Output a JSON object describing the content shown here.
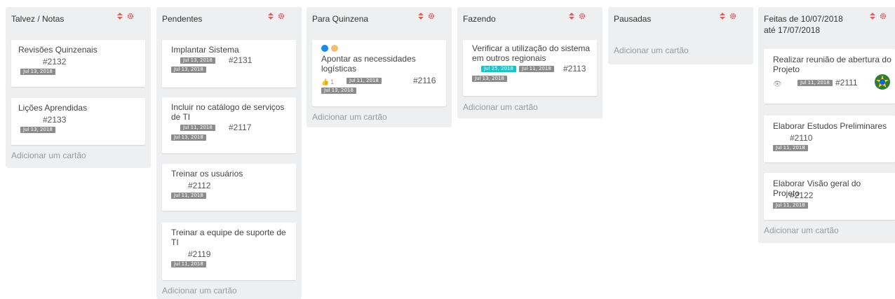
{
  "board": {
    "add_card_label": "Adicionar um cartão",
    "accent_color": "#e06060",
    "lists": [
      {
        "title": "Talvez / Notas",
        "cards": [
          {
            "title": "Revisões Quinzenais",
            "id": "#2132",
            "dates": [
              "Jul 13, 2018"
            ]
          },
          {
            "title": "Lições Aprendidas",
            "id": "#2133",
            "dates": [
              "Jul 13, 2018"
            ]
          }
        ]
      },
      {
        "title": "Pendentes",
        "cards": [
          {
            "title": "Implantar Sistema",
            "id": "#2131",
            "dates": [
              "Jul 13, 2018",
              "Jul 13, 2018"
            ]
          },
          {
            "title": "Incluir no catálogo de serviços de TI",
            "id": "#2117",
            "dates": [
              "Jul 11, 2018",
              "Jul 13, 2018"
            ]
          },
          {
            "title": "Treinar os usuários",
            "id": "#2112",
            "dates": [
              "Jul 11, 2018"
            ]
          },
          {
            "title": "Treinar a equipe de suporte de TI",
            "id": "#2119",
            "dates": [
              "Jul 11, 2018"
            ]
          }
        ]
      },
      {
        "title": "Para Quinzena",
        "cards": [
          {
            "title": "Apontar as necessidades logísticas",
            "id": "#2116",
            "likes": "1",
            "dates": [
              "Jul 11, 2018",
              "Jul 13, 2018"
            ],
            "dot_colors": [
              "#1e88e5",
              "#f0c070"
            ]
          }
        ]
      },
      {
        "title": "Fazendo",
        "cards": [
          {
            "title": "Verificar a utilização do sistema em outros regionais",
            "id": "#2113",
            "dates": [
              "Jul 25, 2018",
              "Jul 11, 2018",
              "Jul 13, 2018"
            ]
          }
        ]
      },
      {
        "title": "Pausadas",
        "cards": []
      },
      {
        "title": "Feitas de 10/07/2018 até 17/07/2018",
        "cards": [
          {
            "title": "Realizar reunião de abertura do Projeto",
            "id": "#2111",
            "dates": [
              "Jul 11, 2018"
            ],
            "icon": "eye-icon",
            "avatar": "brazil-coat-of-arms"
          },
          {
            "title": "Elaborar Estudos Preliminares",
            "id": "#2110",
            "dates": [
              "Jul 11, 2018"
            ]
          },
          {
            "title": "Elaborar Visão geral do Projeto",
            "id": "#2122",
            "dates": [
              "Jul 11, 2018"
            ]
          }
        ]
      }
    ]
  }
}
